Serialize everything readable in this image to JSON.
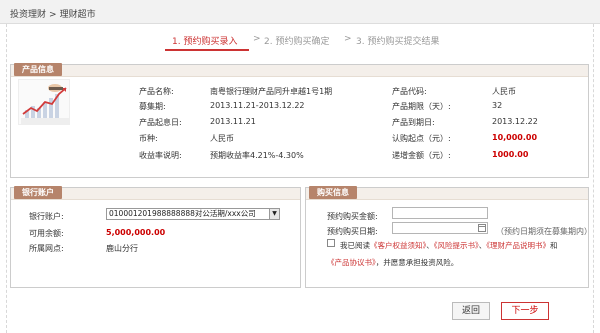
{
  "breadcrumb": {
    "first": "投资理财",
    "sep": ">",
    "second": "理财超市"
  },
  "steps": {
    "step1": "1. 预约购买录入",
    "step2": "2. 预约购买确定",
    "step3": "3. 预约购买提交结果",
    "arrow": ">"
  },
  "product": {
    "section_title": "产品信息",
    "left": [
      {
        "label": "产品名称:",
        "value": "南粤银行理财产品同升卓越1号1期"
      },
      {
        "label": "募集期:",
        "value": "2013.11.21-2013.12.22"
      },
      {
        "label": "产品起息日:",
        "value": "2013.11.21"
      },
      {
        "label": "币种:",
        "value": "人民币"
      },
      {
        "label": "收益率说明:",
        "value": "预期收益率4.21%-4.30%"
      }
    ],
    "right": [
      {
        "label": "产品代码:",
        "value": "人民币"
      },
      {
        "label": "产品期限（天）:",
        "value": "32"
      },
      {
        "label": "产品到期日:",
        "value": "2013.12.22"
      },
      {
        "label": "认购起点（元）:",
        "value": "10,000.00"
      },
      {
        "label": "递增金额（元）:",
        "value": "1000.00"
      }
    ],
    "thumbnail_icon": "growth-chart-icon"
  },
  "bank": {
    "section_title": "银行账户",
    "account_label": "银行账户:",
    "account_value": "010001201988888888对公活期/xxx公司",
    "balance_label": "可用余额:",
    "balance_value": "5,000,000.00",
    "branch_label": "所属网点:",
    "branch_value": "鹿山分行"
  },
  "purchase": {
    "section_title": "购买信息",
    "amount_label": "预约购买金额:",
    "amount_value": "",
    "date_label": "预约购买日期:",
    "date_value": "",
    "date_hint": "（预约日期须在募集期内）",
    "agree_prefix": "我已阅读",
    "doc1": "《客户权益须知》",
    "doc2": "《风险提示书》",
    "doc3": "《理财产品说明书》",
    "and": "和",
    "doc4": "《产品协议书》",
    "agree_suffix": "，并愿意承担投资风险。",
    "sep": "、",
    "checked": false
  },
  "buttons": {
    "back": "返回",
    "next": "下一步"
  },
  "colors": {
    "accent": "#cc3333",
    "tag": "#b6846b",
    "amount_red": "#cc0000"
  }
}
